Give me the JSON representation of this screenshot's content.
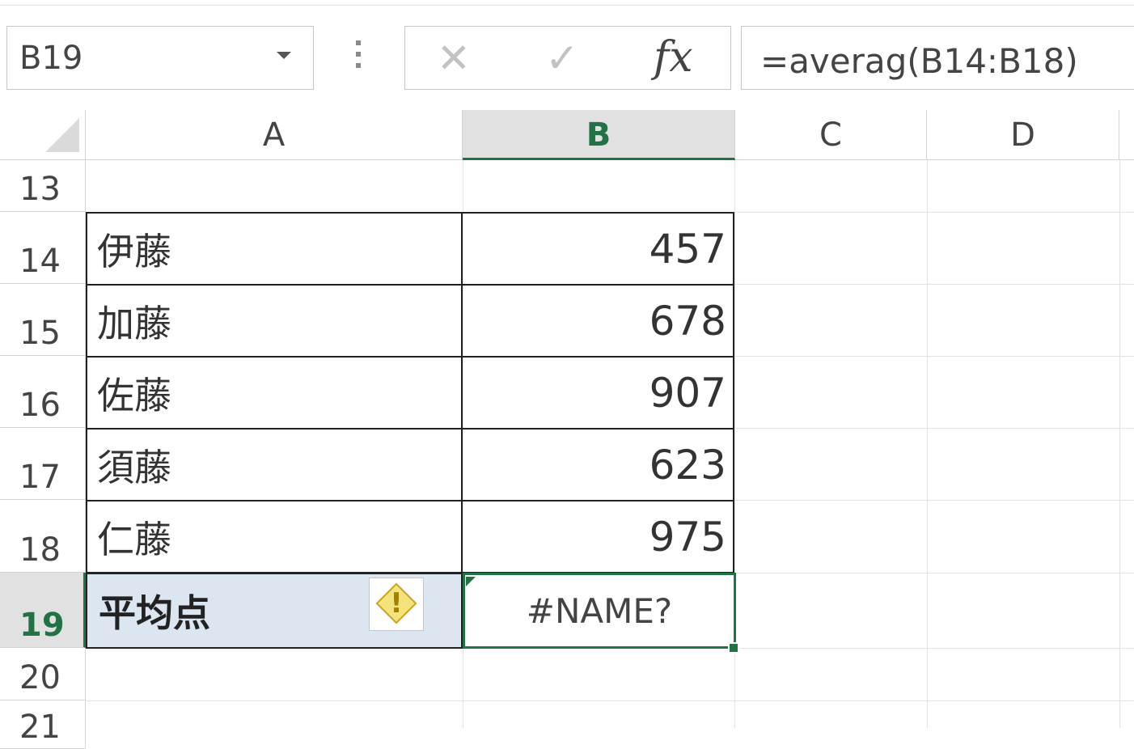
{
  "formula_bar": {
    "name_box": "B19",
    "cancel_glyph": "✕",
    "enter_glyph": "✓",
    "fx_label": "fx",
    "formula": "=averag(B14:B18)"
  },
  "columns": [
    "A",
    "B",
    "C",
    "D"
  ],
  "rows": [
    {
      "num": "13",
      "name": "",
      "value": ""
    },
    {
      "num": "14",
      "name": "伊藤",
      "value": "457"
    },
    {
      "num": "15",
      "name": "加藤",
      "value": "678"
    },
    {
      "num": "16",
      "name": "佐藤",
      "value": "907"
    },
    {
      "num": "17",
      "name": "須藤",
      "value": "623"
    },
    {
      "num": "18",
      "name": "仁藤",
      "value": "975"
    },
    {
      "num": "19",
      "name": "平均点",
      "value": "#NAME?"
    },
    {
      "num": "20",
      "name": "",
      "value": ""
    },
    {
      "num": "21",
      "name": "",
      "value": ""
    }
  ],
  "warning_glyph": "!",
  "colors": {
    "accent": "#217346",
    "selection_fill": "#dce6f1",
    "warning": "#f3e37a"
  }
}
